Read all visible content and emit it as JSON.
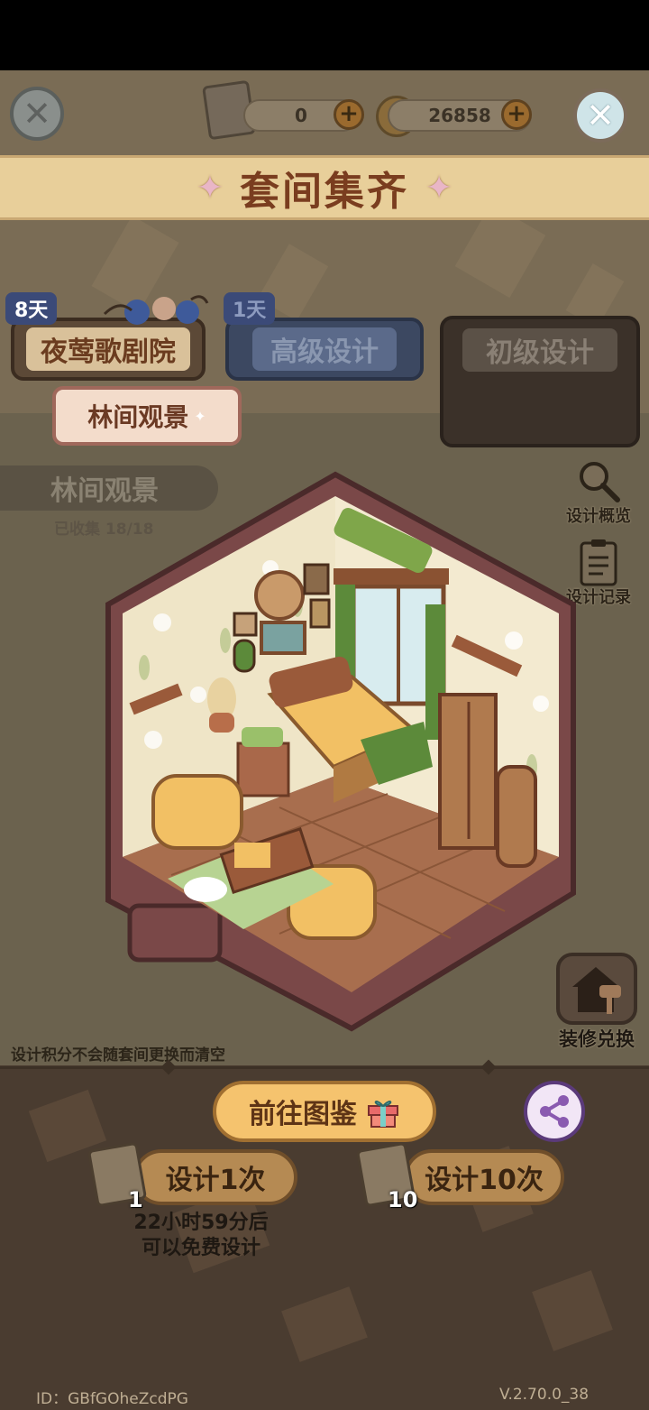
{
  "header": {
    "tickets": "0",
    "coins": "26858",
    "plus_symbol": "+",
    "close_symbol": "✕"
  },
  "title": {
    "text": "套间集齐",
    "star": "✦"
  },
  "tabs": [
    {
      "label": "夜莺歌剧院",
      "badge": "8天"
    },
    {
      "label": "高级设计",
      "badge": "1天"
    },
    {
      "label": "初级设计"
    }
  ],
  "subtab": {
    "label": "林间观景",
    "sparkle": "✦"
  },
  "set": {
    "name": "林间观景",
    "collected": "已收集 18/18"
  },
  "side": {
    "overview": "设计概览",
    "record": "设计记录",
    "exchange": "装修兑换"
  },
  "hint": "设计积分不会随套间更换而清空",
  "bottom": {
    "gallery": "前往图鉴",
    "design_once": "设计1次",
    "design_once_count": "1",
    "design_ten": "设计10次",
    "design_ten_count": "10",
    "free_timer_line1": "22小时59分后",
    "free_timer_line2": "可以免费设计"
  },
  "footer": {
    "id": "ID：GBfGOheZcdPG",
    "version": "V.2.70.0_38"
  }
}
